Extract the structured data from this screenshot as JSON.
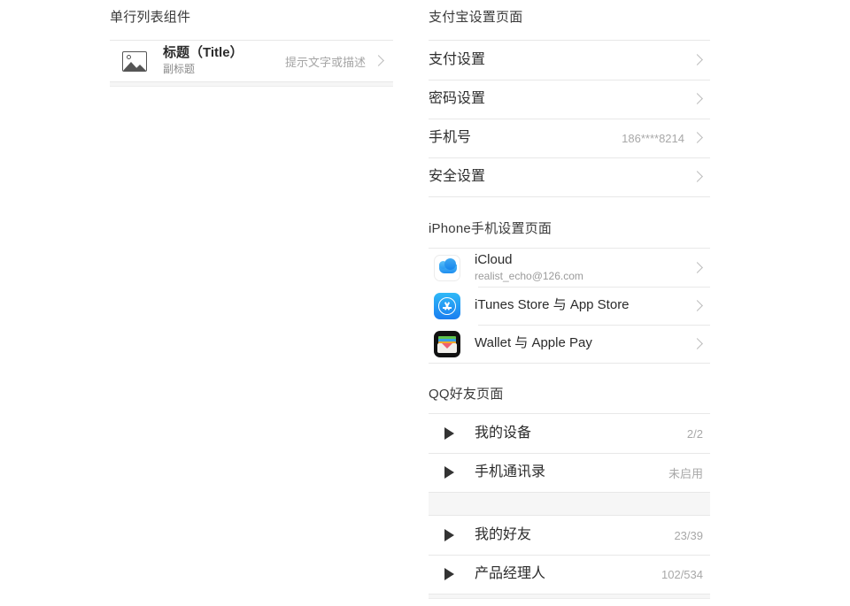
{
  "left_panel": {
    "section_title": "单行列表组件",
    "row": {
      "icon": "image-placeholder-icon",
      "title": "标题（Title）",
      "subtitle": "副标题",
      "value": "提示文字或描述",
      "chevron": "chevron-right-icon"
    }
  },
  "alipay_panel": {
    "section_title": "支付宝设置页面",
    "rows": [
      {
        "title": "支付设置",
        "value": ""
      },
      {
        "title": "密码设置",
        "value": ""
      },
      {
        "title": "手机号",
        "value": "186****8214"
      },
      {
        "title": "安全设置",
        "value": ""
      }
    ]
  },
  "iphone_panel": {
    "section_title": "iPhone手机设置页面",
    "rows": [
      {
        "icon": "icloud-icon",
        "title": "iCloud",
        "subtitle": "realist_echo@126.com"
      },
      {
        "icon": "app-store-icon",
        "title": "iTunes Store 与 App Store",
        "subtitle": ""
      },
      {
        "icon": "wallet-icon",
        "title": "Wallet 与 Apple Pay",
        "subtitle": ""
      }
    ]
  },
  "qq_panel": {
    "section_title": "QQ好友页面",
    "group_one": [
      {
        "title": "我的设备",
        "value": "2/2"
      },
      {
        "title": "手机通讯录",
        "value": "未启用"
      }
    ],
    "group_two": [
      {
        "title": "我的好友",
        "value": "23/39"
      },
      {
        "title": "产品经理人",
        "value": "102/534"
      }
    ]
  },
  "colors": {
    "background": "#ffffff",
    "divider": "#e8e8e8",
    "gap_band": "#f6f6f6",
    "title_text": "#2b2b2b",
    "secondary_text": "#a8a8a8",
    "chevron": "#bdbdbd",
    "triangle": "#333333"
  }
}
